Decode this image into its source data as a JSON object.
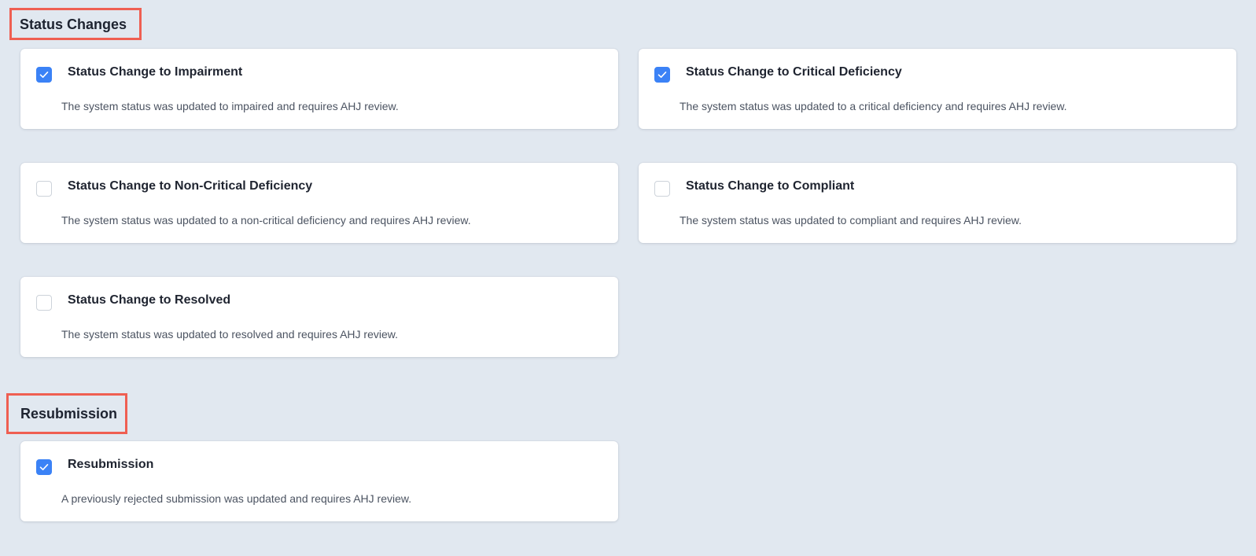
{
  "sections": {
    "status_changes": {
      "title": "Status Changes",
      "cards": [
        {
          "checked": true,
          "title": "Status Change to Impairment",
          "description": "The system status was updated to impaired and requires AHJ review."
        },
        {
          "checked": true,
          "title": "Status Change to Critical Deficiency",
          "description": "The system status was updated to a critical deficiency and requires AHJ review."
        },
        {
          "checked": false,
          "title": "Status Change to Non-Critical Deficiency",
          "description": "The system status was updated to a non-critical deficiency and requires AHJ review."
        },
        {
          "checked": false,
          "title": "Status Change to Compliant",
          "description": "The system status was updated to compliant and requires AHJ review."
        },
        {
          "checked": false,
          "title": "Status Change to Resolved",
          "description": "The system status was updated to resolved and requires AHJ review."
        }
      ]
    },
    "resubmission": {
      "title": "Resubmission",
      "cards": [
        {
          "checked": true,
          "title": "Resubmission",
          "description": "A previously rejected submission was updated and requires AHJ review."
        }
      ]
    }
  },
  "colors": {
    "page_background": "#e1e8f0",
    "checkbox_checked": "#3b82f6",
    "highlight_border": "#ef5f52"
  },
  "icons": {
    "checked": "checkmark-icon"
  }
}
